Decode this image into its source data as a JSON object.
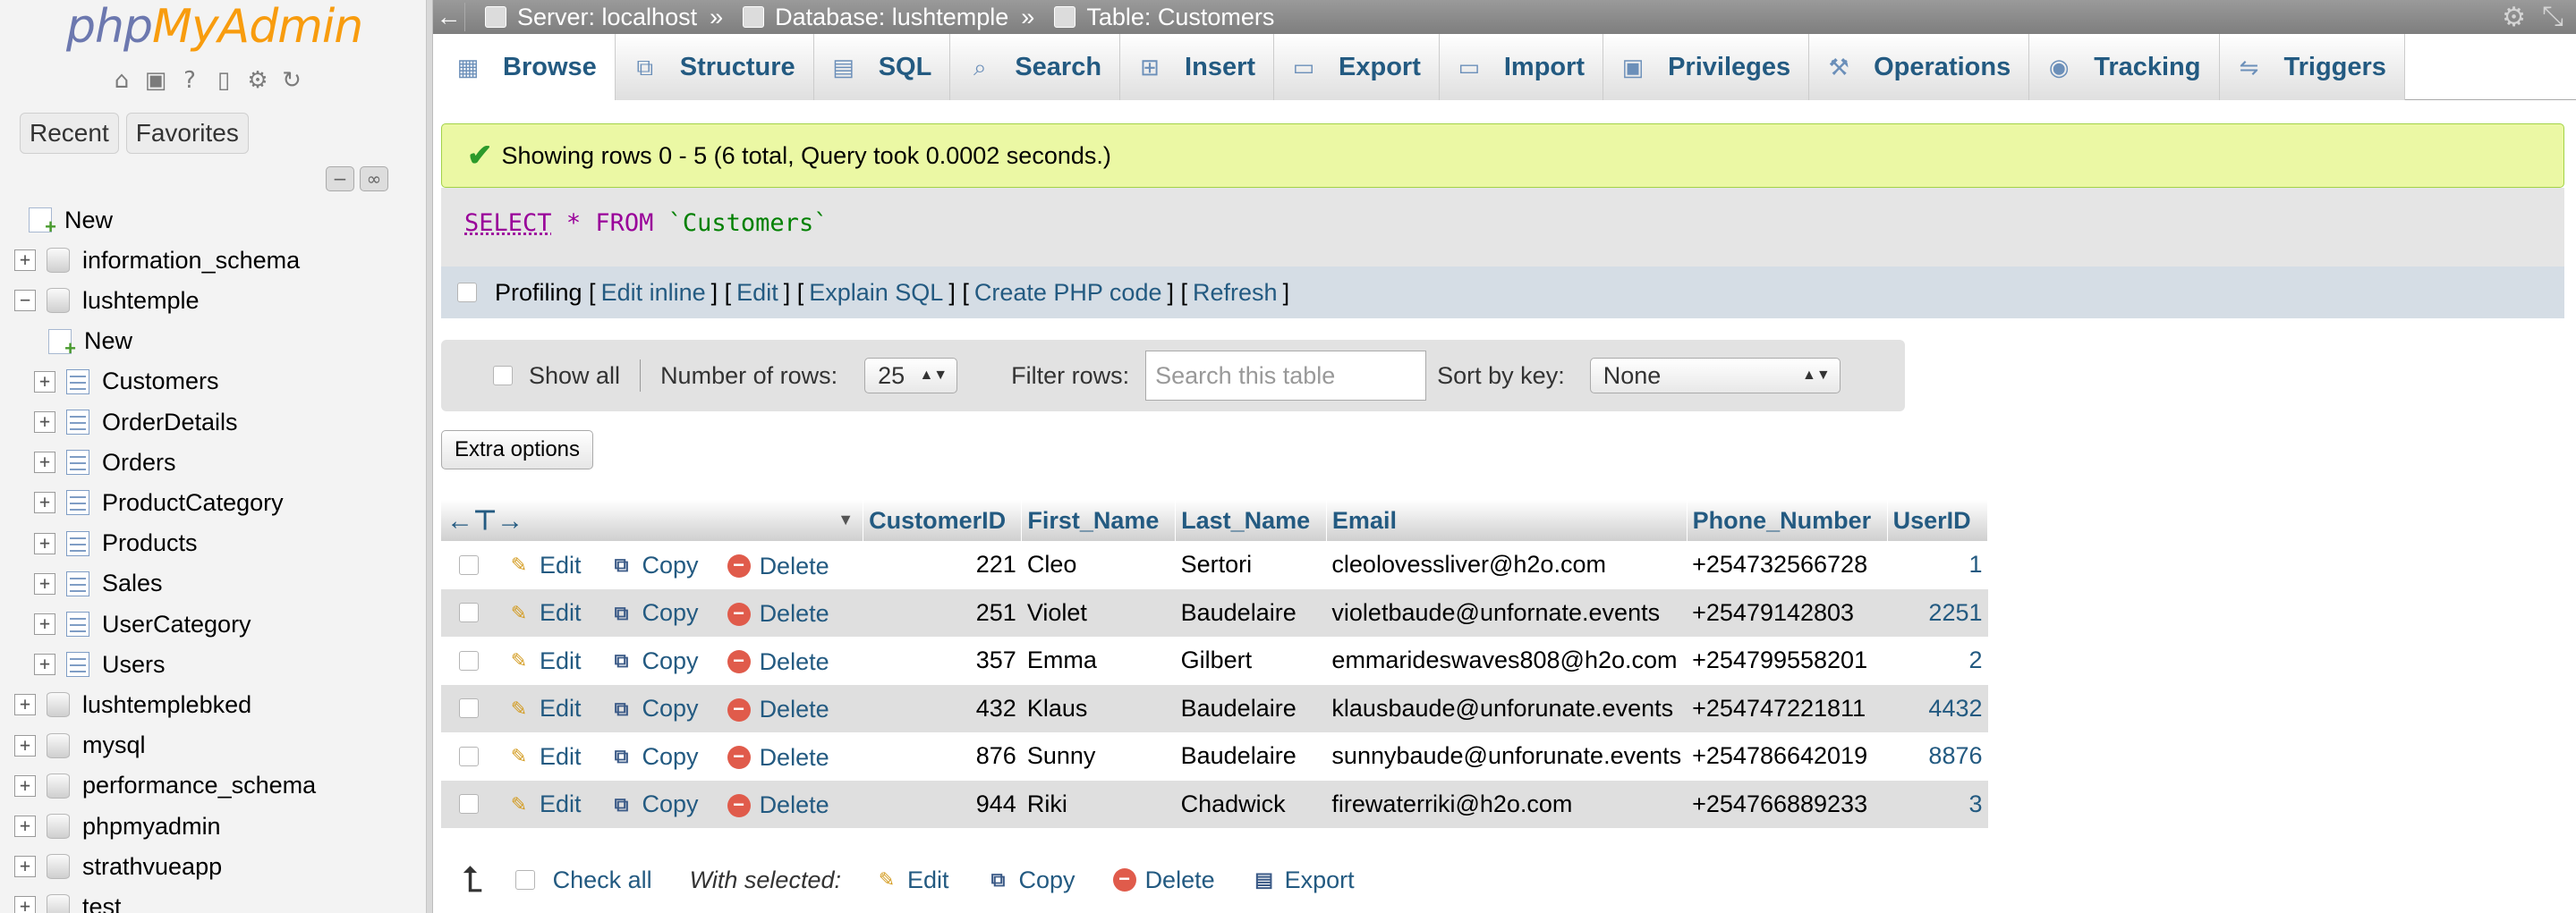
{
  "logo": {
    "part1": "php",
    "part2": "MyAdmin"
  },
  "nav": {
    "tabs": [
      "Recent",
      "Favorites"
    ],
    "tree": [
      {
        "label": "New",
        "kind": "new",
        "level": 0
      },
      {
        "label": "information_schema",
        "kind": "db",
        "level": 0
      },
      {
        "label": "lushtemple",
        "kind": "db",
        "level": 0,
        "expanded": true
      },
      {
        "label": "New",
        "kind": "new",
        "level": 1
      },
      {
        "label": "Customers",
        "kind": "table",
        "level": 1,
        "selected": true
      },
      {
        "label": "OrderDetails",
        "kind": "table",
        "level": 1
      },
      {
        "label": "Orders",
        "kind": "table",
        "level": 1
      },
      {
        "label": "ProductCategory",
        "kind": "table",
        "level": 1
      },
      {
        "label": "Products",
        "kind": "table",
        "level": 1
      },
      {
        "label": "Sales",
        "kind": "table",
        "level": 1
      },
      {
        "label": "UserCategory",
        "kind": "table",
        "level": 1
      },
      {
        "label": "Users",
        "kind": "table",
        "level": 1
      },
      {
        "label": "lushtemplebked",
        "kind": "db",
        "level": 0
      },
      {
        "label": "mysql",
        "kind": "db",
        "level": 0
      },
      {
        "label": "performance_schema",
        "kind": "db",
        "level": 0
      },
      {
        "label": "phpmyadmin",
        "kind": "db",
        "level": 0
      },
      {
        "label": "strathvueapp",
        "kind": "db",
        "level": 0
      },
      {
        "label": "test",
        "kind": "db",
        "level": 0
      }
    ]
  },
  "breadcrumb": {
    "server": "Server: localhost",
    "database": "Database: lushtemple",
    "table": "Table: Customers",
    "separator": "»"
  },
  "tabs": [
    {
      "label": "Browse",
      "icon": "browse-icon"
    },
    {
      "label": "Structure",
      "icon": "structure-icon"
    },
    {
      "label": "SQL",
      "icon": "sql-icon"
    },
    {
      "label": "Search",
      "icon": "search-icon"
    },
    {
      "label": "Insert",
      "icon": "insert-icon"
    },
    {
      "label": "Export",
      "icon": "export-icon"
    },
    {
      "label": "Import",
      "icon": "import-icon"
    },
    {
      "label": "Privileges",
      "icon": "privileges-icon"
    },
    {
      "label": "Operations",
      "icon": "operations-icon"
    },
    {
      "label": "Tracking",
      "icon": "tracking-icon"
    },
    {
      "label": "Triggers",
      "icon": "triggers-icon"
    }
  ],
  "message": "Showing rows 0 - 5 (6 total, Query took 0.0002 seconds.)",
  "sql": {
    "select": "SELECT",
    "star": "*",
    "from": "FROM",
    "table": "`Customers`"
  },
  "profiling": {
    "label": "Profiling",
    "links": [
      "Edit inline",
      "Edit",
      "Explain SQL",
      "Create PHP code",
      "Refresh"
    ]
  },
  "navrow": {
    "show_all": "Show all",
    "rows_label": "Number of rows:",
    "rows_value": "25",
    "filter_label": "Filter rows:",
    "filter_placeholder": "Search this table",
    "sort_label": "Sort by key:",
    "sort_value": "None"
  },
  "extra_options": "Extra options",
  "table": {
    "columns": [
      "CustomerID",
      "First_Name",
      "Last_Name",
      "Email",
      "Phone_Number",
      "UserID"
    ],
    "actions": {
      "edit": "Edit",
      "copy": "Copy",
      "delete": "Delete"
    },
    "rows": [
      [
        "221",
        "Cleo",
        "Sertori",
        "cleolovessliver@h2o.com",
        "+254732566728",
        "1"
      ],
      [
        "251",
        "Violet",
        "Baudelaire",
        "violetbaude@unfornate.events",
        "+25479142803",
        "2251"
      ],
      [
        "357",
        "Emma",
        "Gilbert",
        "emmarideswaves808@h2o.com",
        "+254799558201",
        "2"
      ],
      [
        "432",
        "Klaus",
        "Baudelaire",
        "klausbaude@unforunate.events",
        "+254747221811",
        "4432"
      ],
      [
        "876",
        "Sunny",
        "Baudelaire",
        "sunnybaude@unforunate.events",
        "+254786642019",
        "8876"
      ],
      [
        "944",
        "Riki",
        "Chadwick",
        "firewaterriki@h2o.com",
        "+254766889233",
        "3"
      ]
    ]
  },
  "bottom": {
    "check_all": "Check all",
    "with_selected": "With selected:",
    "edit": "Edit",
    "copy": "Copy",
    "delete": "Delete",
    "export": "Export"
  }
}
